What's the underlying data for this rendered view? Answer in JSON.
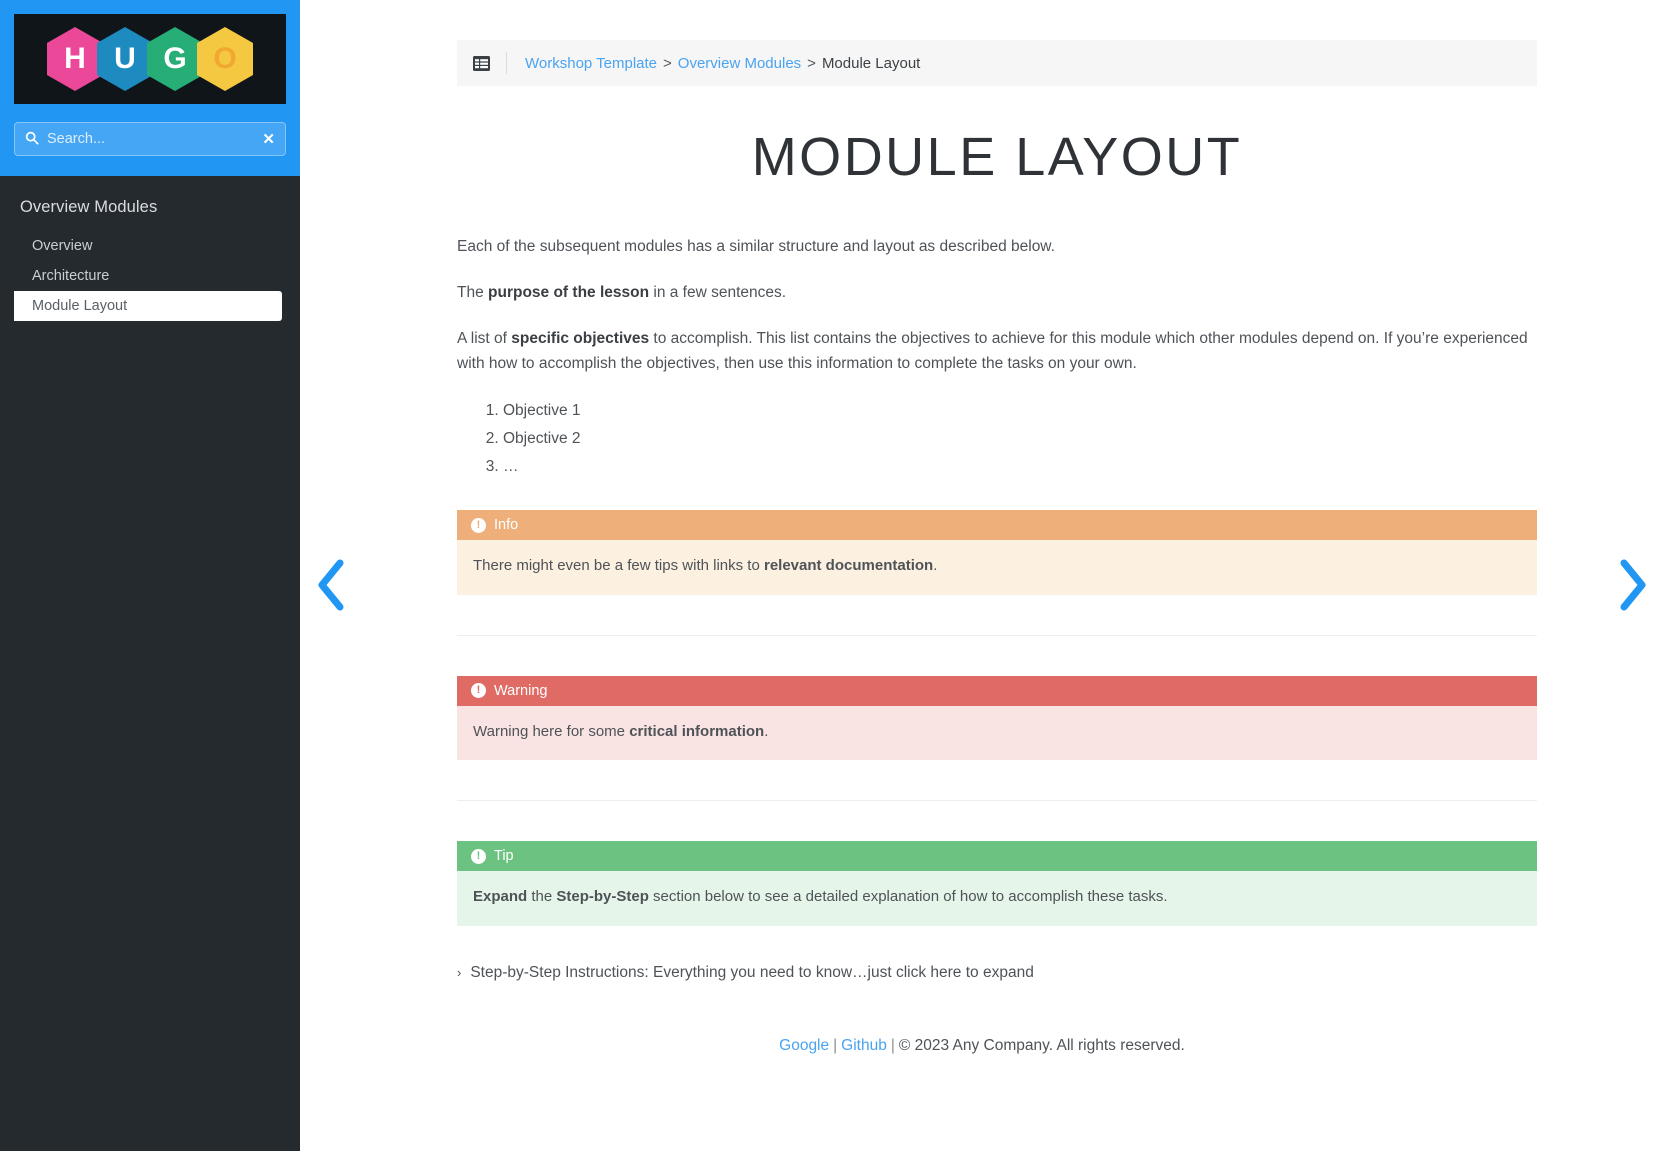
{
  "sidebar": {
    "logo": {
      "alt": "HUGO",
      "letters": [
        "H",
        "U",
        "G",
        "O"
      ],
      "colors": [
        "#ec4899",
        "#1d8bc0",
        "#27ae77",
        "#f5c842"
      ],
      "background": "#0f1519"
    },
    "search": {
      "placeholder": "Search...",
      "value": "",
      "icon": "search-icon",
      "clear_icon": "✕"
    },
    "nav_heading": "Overview Modules",
    "items": [
      {
        "label": "Overview",
        "active": false
      },
      {
        "label": "Architecture",
        "active": false
      },
      {
        "label": "Module Layout",
        "active": true
      }
    ],
    "accent_color": "#2196f3",
    "background_color": "#252a2f"
  },
  "breadcrumb": {
    "icon": "table-list-icon",
    "links": [
      "Workshop Template",
      "Overview Modules"
    ],
    "separator": ">",
    "current": "Module Layout"
  },
  "page": {
    "title": "Module Layout"
  },
  "content": {
    "intro": "Each of the subsequent modules has a similar structure and layout as described below.",
    "purpose_prefix": "The ",
    "purpose_bold": "purpose of the lesson",
    "purpose_suffix": " in a few sentences.",
    "objectives_prefix": "A list of ",
    "objectives_bold": "specific objectives",
    "objectives_suffix": " to accomplish. This list contains the objectives to achieve for this module which other modules depend on. If you’re experienced with how to accomplish the objectives, then use this information to complete the tasks on your own.",
    "objectives_list": [
      "Objective 1",
      "Objective 2",
      "…"
    ]
  },
  "callouts": {
    "info": {
      "title": "Info",
      "icon": "exclamation-circle-icon",
      "header_color": "#eeaf7a",
      "body_color": "#fcf0e0",
      "text_prefix": "There might even be a few tips with links to ",
      "text_bold": "relevant documentation",
      "text_suffix": "."
    },
    "warning": {
      "title": "Warning",
      "icon": "exclamation-circle-icon",
      "header_color": "#e06b65",
      "body_color": "#f9e4e3",
      "text_prefix": "Warning here for some ",
      "text_bold": "critical information",
      "text_suffix": "."
    },
    "tip": {
      "title": "Tip",
      "icon": "exclamation-circle-icon",
      "header_color": "#6cc381",
      "body_color": "#e6f5e9",
      "text_bold1": "Expand",
      "text_mid1": " the ",
      "text_bold2": "Step-by-Step",
      "text_suffix": " section below to see a detailed explanation of how to accomplish these tasks."
    }
  },
  "expander": {
    "chevron": "›",
    "label": "Step-by-Step Instructions: Everything you need to know…just click here to expand"
  },
  "footer": {
    "link1": "Google",
    "link2": "Github",
    "pipe": "|",
    "copyright": "© 2023 Any Company. All rights reserved."
  },
  "nav_arrows": {
    "prev": "prev-page-arrow",
    "next": "next-page-arrow",
    "color": "#2196f3"
  }
}
